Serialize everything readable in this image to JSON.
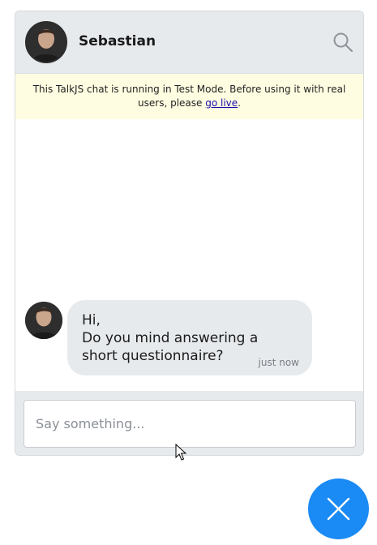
{
  "header": {
    "name": "Sebastian"
  },
  "banner": {
    "text_before": "This TalkJS chat is running in Test Mode. Before using it with real users, please ",
    "link_text": "go live",
    "text_after": "."
  },
  "messages": [
    {
      "text": "Hi,\nDo you mind answering a short questionnaire?",
      "time": "just now"
    }
  ],
  "composer": {
    "placeholder": "Say something..."
  },
  "colors": {
    "header_bg": "#e7eaed",
    "banner_bg": "#fffde1",
    "bubble_bg": "#e7eaed",
    "launcher_blue": "#1a8af5"
  },
  "icons": {
    "search": "search-icon",
    "close": "close-icon",
    "avatar": "avatar"
  }
}
